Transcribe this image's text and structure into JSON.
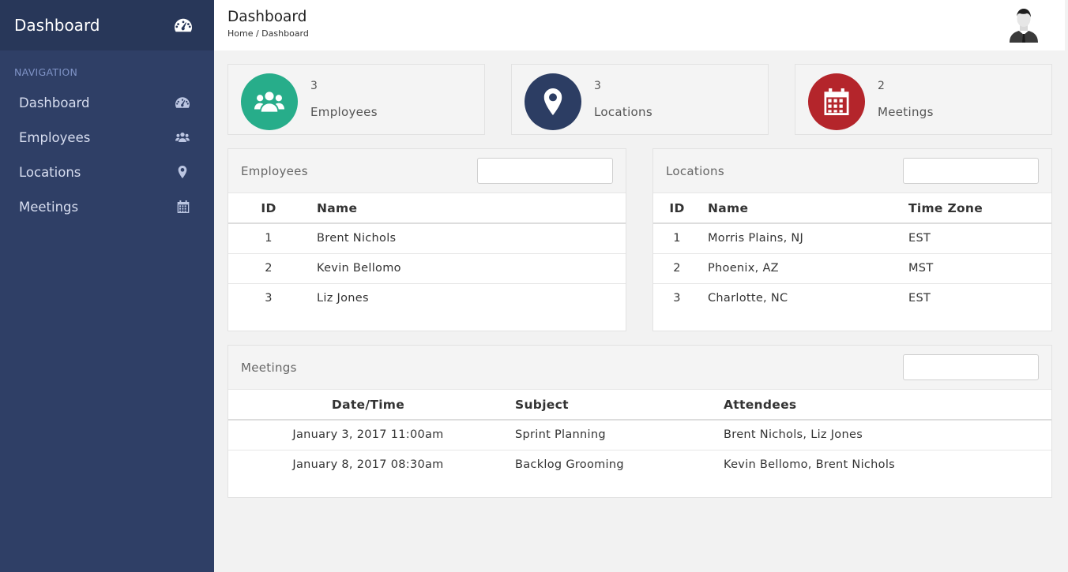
{
  "sidebar": {
    "brand": "Dashboard",
    "nav_heading": "NAVIGATION",
    "items": [
      {
        "label": "Dashboard",
        "icon": "dashboard-icon"
      },
      {
        "label": "Employees",
        "icon": "users-icon"
      },
      {
        "label": "Locations",
        "icon": "map-pin-icon"
      },
      {
        "label": "Meetings",
        "icon": "calendar-icon"
      }
    ]
  },
  "header": {
    "title": "Dashboard",
    "breadcrumb": "Home / Dashboard"
  },
  "stats": [
    {
      "count": "3",
      "label": "Employees",
      "color": "#27ad8a",
      "icon": "users-icon"
    },
    {
      "count": "3",
      "label": "Locations",
      "color": "#2c3d63",
      "icon": "map-pin-icon"
    },
    {
      "count": "2",
      "label": "Meetings",
      "color": "#b4252b",
      "icon": "calendar-icon"
    }
  ],
  "employees": {
    "title": "Employees",
    "search_value": "",
    "columns": [
      "ID",
      "Name"
    ],
    "rows": [
      [
        "1",
        "Brent Nichols"
      ],
      [
        "2",
        "Kevin Bellomo"
      ],
      [
        "3",
        "Liz Jones"
      ]
    ]
  },
  "locations": {
    "title": "Locations",
    "search_value": "",
    "columns": [
      "ID",
      "Name",
      "Time Zone"
    ],
    "rows": [
      [
        "1",
        "Morris Plains, NJ",
        "EST"
      ],
      [
        "2",
        "Phoenix, AZ",
        "MST"
      ],
      [
        "3",
        "Charlotte, NC",
        "EST"
      ]
    ]
  },
  "meetings": {
    "title": "Meetings",
    "search_value": "",
    "columns": [
      "Date/Time",
      "Subject",
      "Attendees"
    ],
    "rows": [
      [
        "January 3, 2017 11:00am",
        "Sprint Planning",
        "Brent Nichols, Liz Jones"
      ],
      [
        "January 8, 2017 08:30am",
        "Backlog Grooming",
        "Kevin Bellomo, Brent Nichols"
      ]
    ]
  },
  "colors": {
    "sidebar": "#2f3f66",
    "brand_bar": "#283759",
    "nav_heading": "#7f93c6"
  }
}
